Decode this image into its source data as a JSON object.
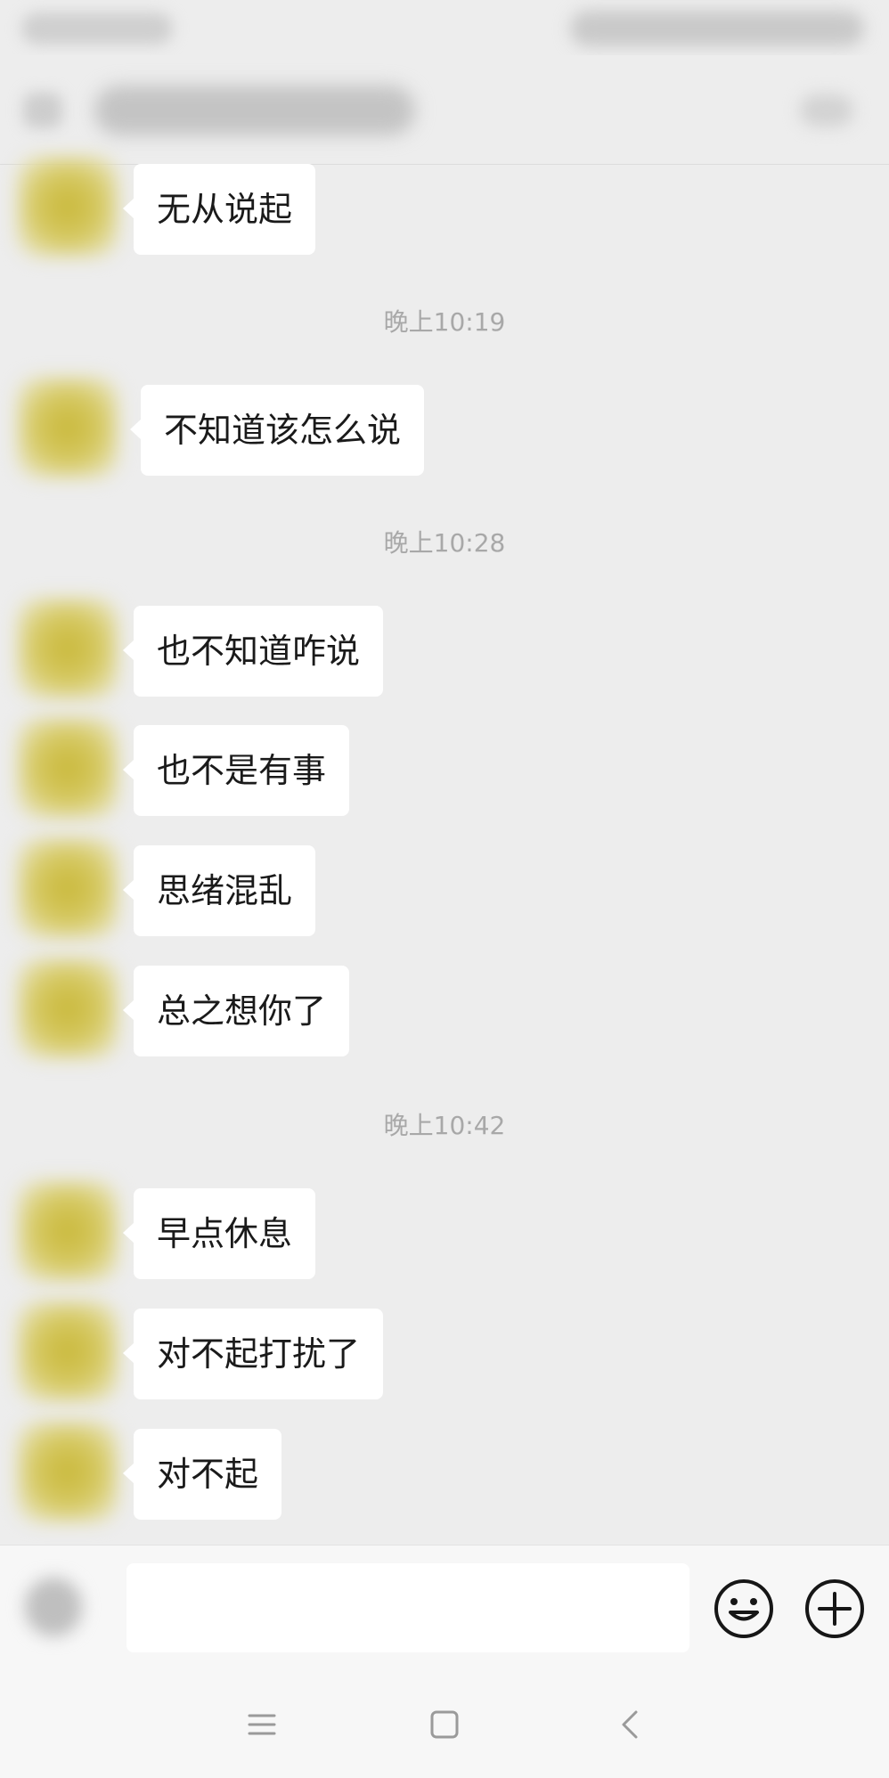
{
  "messages": [
    {
      "type": "message",
      "text": "无从说起"
    },
    {
      "type": "time",
      "text": "晚上10:19"
    },
    {
      "type": "message",
      "text": "不知道该怎么说"
    },
    {
      "type": "time",
      "text": "晚上10:28"
    },
    {
      "type": "message",
      "text": "也不知道咋说"
    },
    {
      "type": "message",
      "text": "也不是有事"
    },
    {
      "type": "message",
      "text": "思绪混乱"
    },
    {
      "type": "message",
      "text": "总之想你了"
    },
    {
      "type": "time",
      "text": "晚上10:42"
    },
    {
      "type": "message",
      "text": "早点休息"
    },
    {
      "type": "message",
      "text": "对不起打扰了"
    },
    {
      "type": "message",
      "text": "对不起"
    }
  ],
  "input": {
    "value": ""
  },
  "icons": {
    "emoji": "smiley-face-icon",
    "plus": "plus-circle-icon",
    "nav_menu": "menu-lines-icon",
    "nav_home": "square-home-icon",
    "nav_back": "chevron-left-icon"
  },
  "colors": {
    "background": "#ededed",
    "bubble": "#ffffff",
    "timestamp": "#a8a8a8",
    "text": "#1a1a1a"
  }
}
